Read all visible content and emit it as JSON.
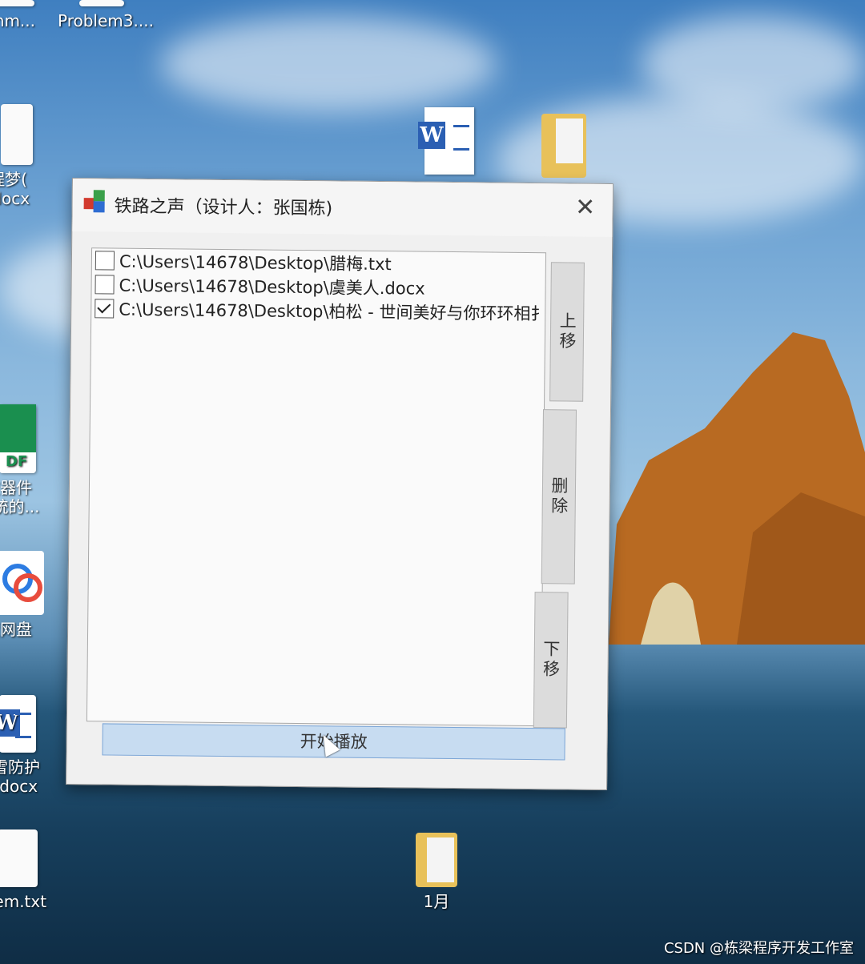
{
  "desktop": {
    "icons": [
      {
        "label_lines": [
          "mm...",
          ""
        ],
        "kind": "file"
      },
      {
        "label_lines": [
          "Problem3....",
          ""
        ],
        "kind": "file"
      },
      {
        "label_lines": [
          "程梦(",
          ".docx"
        ],
        "kind": "word"
      },
      {
        "label_lines": [
          "波器件",
          "系统的..."
        ],
        "kind": "pdf"
      },
      {
        "label_lines": [
          "度网盘",
          ""
        ],
        "kind": "baidu"
      },
      {
        "label_lines": [
          "除雪防护",
          "司.docx"
        ],
        "kind": "word"
      },
      {
        "label_lines": [
          "oblem.txt",
          ""
        ],
        "kind": "txt"
      },
      {
        "label_lines": [
          "1月",
          ""
        ],
        "kind": "folder"
      }
    ],
    "pdf_tag": "DF",
    "watermark": "CSDN @栋梁程序开发工作室"
  },
  "window": {
    "title": "铁路之声（设计人：张国栋)",
    "close_glyph": "✕",
    "list": {
      "items": [
        {
          "path": "C:\\Users\\14678\\Desktop\\腊梅.txt",
          "checked": false
        },
        {
          "path": "C:\\Users\\14678\\Desktop\\虞美人.docx",
          "checked": false
        },
        {
          "path": "C:\\Users\\14678\\Desktop\\柏松 - 世间美好与你环环相扌",
          "checked": true
        }
      ]
    },
    "buttons": {
      "move_up": "上移",
      "delete": "删除",
      "move_down": "下移",
      "play": "开始播放"
    }
  }
}
